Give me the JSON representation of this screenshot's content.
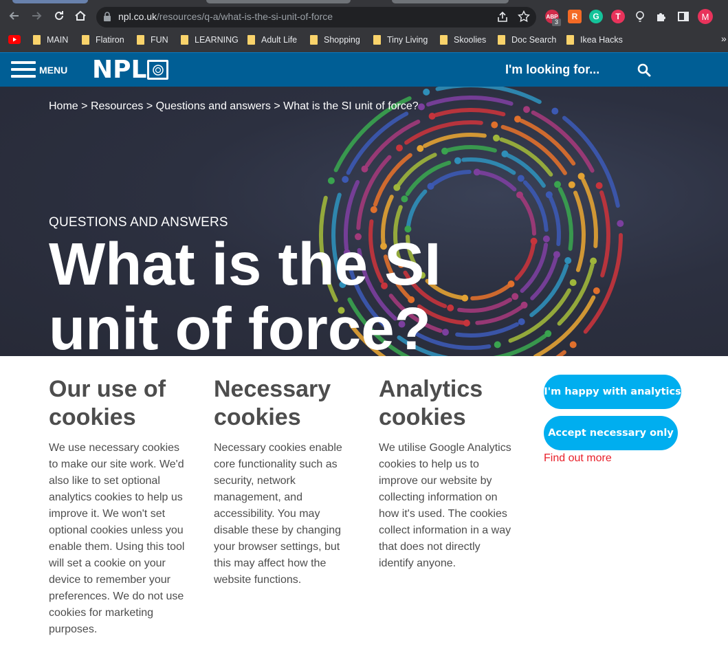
{
  "browser": {
    "url_host": "npl.co.uk",
    "url_path": "/resources/q-a/what-is-the-si-unit-of-force",
    "extensions": [
      {
        "name": "adblock-icon",
        "badge": "3"
      },
      {
        "name": "rakuten-icon",
        "letter": "R"
      },
      {
        "name": "grammarly-icon",
        "letter": "G"
      },
      {
        "name": "todoist-icon",
        "letter": "T"
      },
      {
        "name": "bulb-icon",
        "letter": ""
      },
      {
        "name": "extensions-puzzle-icon",
        "letter": ""
      },
      {
        "name": "sidepanel-icon",
        "letter": ""
      }
    ],
    "profile_initial": "M"
  },
  "bookmarks": [
    "MAIN",
    "Flatiron",
    "FUN",
    "LEARNING",
    "Adult Life",
    "Shopping",
    "Tiny Living",
    "Skoolies",
    "Doc Search",
    "Ikea Hacks"
  ],
  "header": {
    "menu_label": "MENU",
    "logo_text": "NPL",
    "search_prompt": "I'm looking for..."
  },
  "hero": {
    "breadcrumb": [
      "Home",
      ">",
      "Resources",
      ">",
      "Questions and answers",
      ">",
      "What is the SI unit of force?"
    ],
    "eyebrow": "QUESTIONS AND ANSWERS",
    "title_line1": "What is the SI",
    "title_line2": "unit of force?"
  },
  "cookies": {
    "columns": [
      {
        "title": "Our use of cookies",
        "body": "We use necessary cookies to make our site work. We'd also like to set optional analytics cookies to help us improve it. We won't set optional cookies unless you enable them. Using this tool will set a cookie on your device to remember your preferences. We do not use cookies for marketing purposes."
      },
      {
        "title": "Necessary cookies",
        "body": "Necessary cookies enable core functionality such as security, network management, and accessibility. You may disable these by changing your browser settings, but this may affect how the website functions."
      },
      {
        "title": "Analytics cookies",
        "body": "We utilise Google Analytics cookies to help us to improve our website by collecting information on how it's used. The cookies collect information in a way that does not directly identify anyone."
      }
    ],
    "accept_analytics_label": "I'm happy with analytics",
    "accept_necessary_label": "Accept necessary only",
    "find_out_more": "Find out more"
  },
  "colors": {
    "header_blue": "#005e95",
    "button_cyan": "#00aeef",
    "link_red": "#e8202a"
  }
}
